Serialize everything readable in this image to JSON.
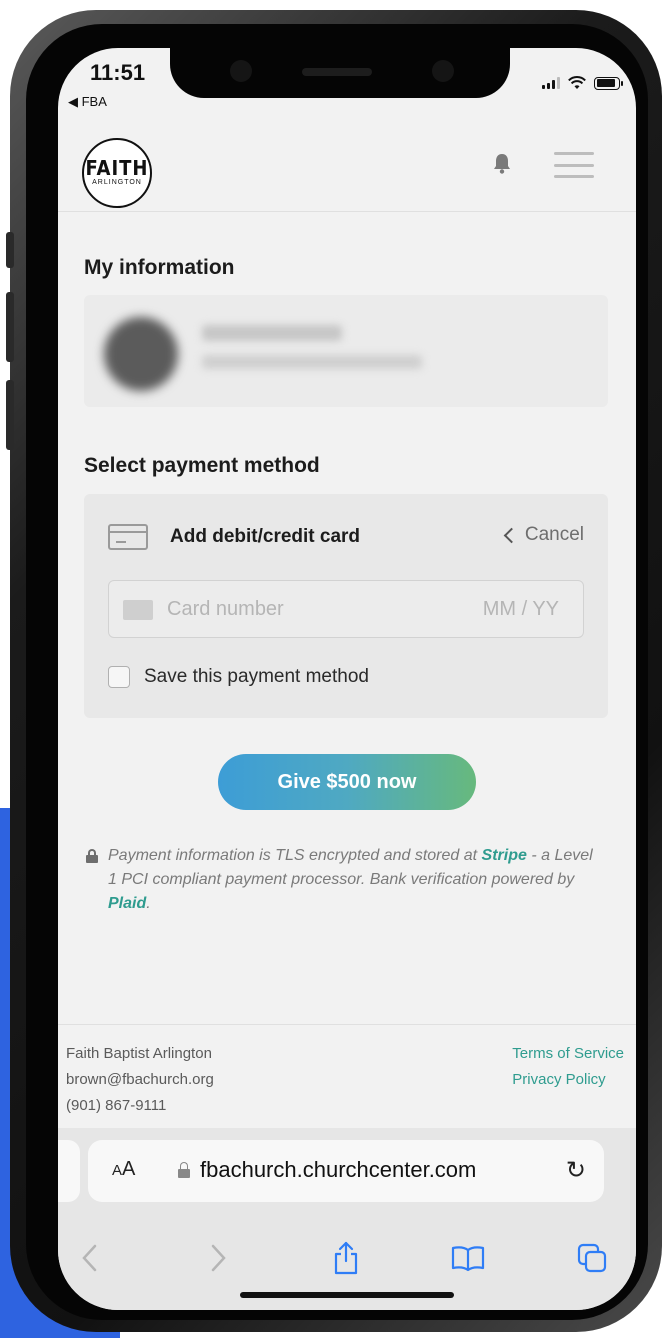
{
  "status_bar": {
    "time": "11:51",
    "back_app": "◀ FBA",
    "icons": [
      "cellular-signal-icon",
      "wifi-icon",
      "battery-icon"
    ]
  },
  "header": {
    "logo_text": "FAITH",
    "logo_subtext": "ARLINGTON",
    "icons": [
      "bell-icon",
      "hamburger-menu-icon"
    ]
  },
  "my_information": {
    "title": "My information"
  },
  "payment": {
    "title": "Select payment method",
    "add_card_label": "Add debit/credit card",
    "cancel_label": "Cancel",
    "card_number_placeholder": "Card number",
    "expiry_placeholder": "MM / YY",
    "save_label": "Save this payment method",
    "save_checked": false
  },
  "give_button": {
    "label": "Give $500 now"
  },
  "security_note": {
    "part1": "Payment information is TLS encrypted and stored at ",
    "brand1": "Stripe",
    "part2": " - a Level 1 PCI compliant payment processor. Bank verification powered by ",
    "brand2": "Plaid",
    "part3": "."
  },
  "footer": {
    "org_name": "Faith Baptist Arlington",
    "email": "brown@fbachurch.org",
    "phone": "(901) 867-9111",
    "terms_link": "Terms of Service",
    "privacy_link": "Privacy Policy"
  },
  "browser": {
    "text_size_small": "A",
    "text_size_big": "A",
    "url": "fbachurch.churchcenter.com",
    "reload_glyph": "↻",
    "toolbar_icons": [
      "back-icon",
      "forward-icon",
      "share-icon",
      "bookmarks-icon",
      "tabs-icon"
    ]
  },
  "colors": {
    "accent_teal": "#2f9c8f",
    "button_gradient_start": "#3d9dd6",
    "button_gradient_end": "#67b97d",
    "background_blue": "#2e63e0"
  }
}
